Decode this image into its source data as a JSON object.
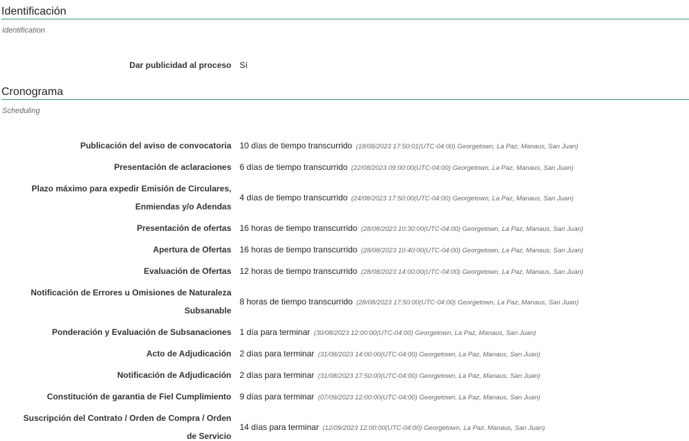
{
  "identificacion": {
    "title": "Identificación",
    "subtitle": "Identification",
    "publicidad_label": "Dar publicidad al proceso",
    "publicidad_value": "Sí"
  },
  "cronograma": {
    "title": "Cronograma",
    "subtitle": "Scheduling",
    "rows": [
      {
        "label": "Publicación del aviso de convocatoria",
        "value": "10 días de tiempo transcurrido",
        "date": "(18/08/2023 17:50:01(UTC-04:00) Georgetown, La Paz, Manaus, San Juan)"
      },
      {
        "label": "Presentación de aclaraciones",
        "value": "6 días de tiempo transcurrido",
        "date": "(22/08/2023 09:00:00(UTC-04:00) Georgetown, La Paz, Manaus, San Juan)"
      },
      {
        "label": "Plazo máximo para expedir Emisión de Circulares, Enmiendas y/o Adendas",
        "value": "4 días de tiempo transcurrido",
        "date": "(24/08/2023 17:50:00(UTC-04:00) Georgetown, La Paz, Manaus, San Juan)"
      },
      {
        "label": "Presentación de ofertas",
        "value": "16 horas de tiempo transcurrido",
        "date": "(28/08/2023 10:30:00(UTC-04:00) Georgetown, La Paz, Manaus, San Juan)"
      },
      {
        "label": "Apertura de Ofertas",
        "value": "16 horas de tiempo transcurrido",
        "date": "(28/08/2023 10:40:00(UTC-04:00) Georgetown, La Paz, Manaus, San Juan)"
      },
      {
        "label": "Evaluación de Ofertas",
        "value": "12 horas de tiempo transcurrido",
        "date": "(28/08/2023 14:00:00(UTC-04:00) Georgetown, La Paz, Manaus, San Juan)"
      },
      {
        "label": "Notificación de Errores u Omisiones de Naturaleza Subsanable",
        "value": "8 horas de tiempo transcurrido",
        "date": "(28/08/2023 17:50:00(UTC-04:00) Georgetown, La Paz, Manaus, San Juan)"
      },
      {
        "label": "Ponderación y Evaluación de Subsanaciones",
        "value": "1 día para terminar",
        "date": "(30/08/2023 12:00:00(UTC-04:00) Georgetown, La Paz, Manaus, San Juan)"
      },
      {
        "label": "Acto de Adjudicación",
        "value": "2 días para terminar",
        "date": "(31/08/2023 14:00:00(UTC-04:00) Georgetown, La Paz, Manaus, San Juan)"
      },
      {
        "label": "Notificación de Adjudicación",
        "value": "2 días para terminar",
        "date": "(31/08/2023 17:50:00(UTC-04:00) Georgetown, La Paz, Manaus, San Juan)"
      },
      {
        "label": "Constitución de garantia de Fiel Cumplimiento",
        "value": "9 días para terminar",
        "date": "(07/09/2023 12:00:00(UTC-04:00) Georgetown, La Paz, Manaus, San Juan)"
      },
      {
        "label": "Suscripción del Contrato / Orden de Compra / Orden de Servicio",
        "value": "14 días para terminar",
        "date": "(12/09/2023 12:00:00(UTC-04:00) Georgetown, La Paz, Manaus, San Juan)"
      }
    ]
  }
}
